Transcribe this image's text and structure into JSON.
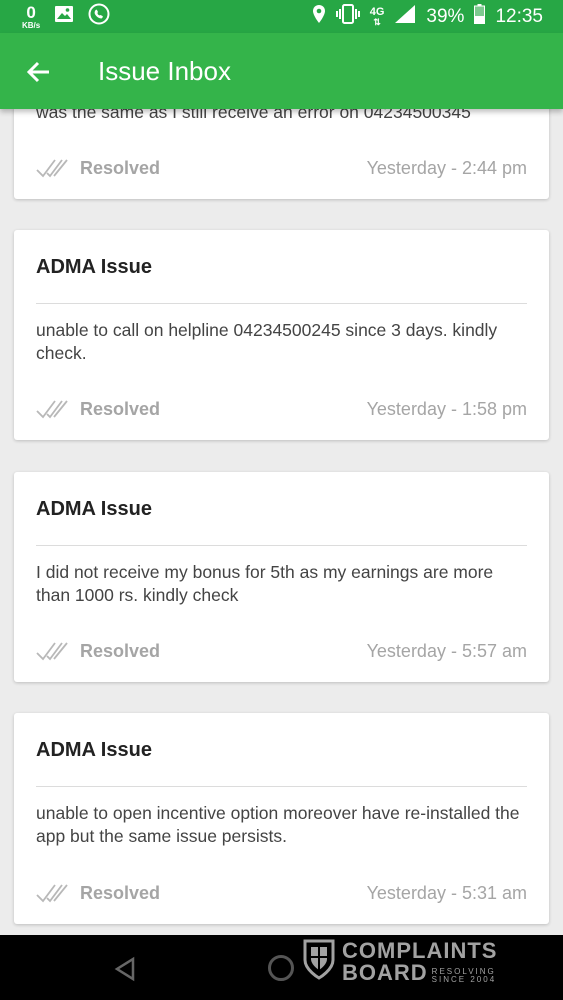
{
  "status_bar": {
    "kbs_value": "0",
    "kbs_unit": "KB/s",
    "network": "4G",
    "battery": "39%",
    "time": "12:35"
  },
  "app_bar": {
    "title": "Issue Inbox"
  },
  "partial_card": {
    "body": "was the same as I still receive an error on 04234500345",
    "status": "Resolved",
    "time": "Yesterday - 2:44 pm"
  },
  "cards": [
    {
      "title": "ADMA Issue",
      "body": "unable to call on helpline 04234500245 since 3 days. kindly check.",
      "status": "Resolved",
      "time": "Yesterday - 1:58 pm"
    },
    {
      "title": "ADMA Issue",
      "body": "I did not receive my bonus for 5th as my earnings are more than 1000 rs. kindly check",
      "status": "Resolved",
      "time": "Yesterday - 5:57 am"
    },
    {
      "title": "ADMA Issue",
      "body": "unable to open incentive option moreover have re-installed the app but the same issue persists.",
      "status": "Resolved",
      "time": "Yesterday - 5:31 am"
    }
  ],
  "watermark": {
    "line1": "COMPLAINTS",
    "line2": "BOARD",
    "sub1": "RESOLVING",
    "sub2": "SINCE 2004"
  },
  "colors": {
    "status_bar": "#27a745",
    "app_bar": "#34b44a",
    "muted_text": "#a5a5a5"
  }
}
